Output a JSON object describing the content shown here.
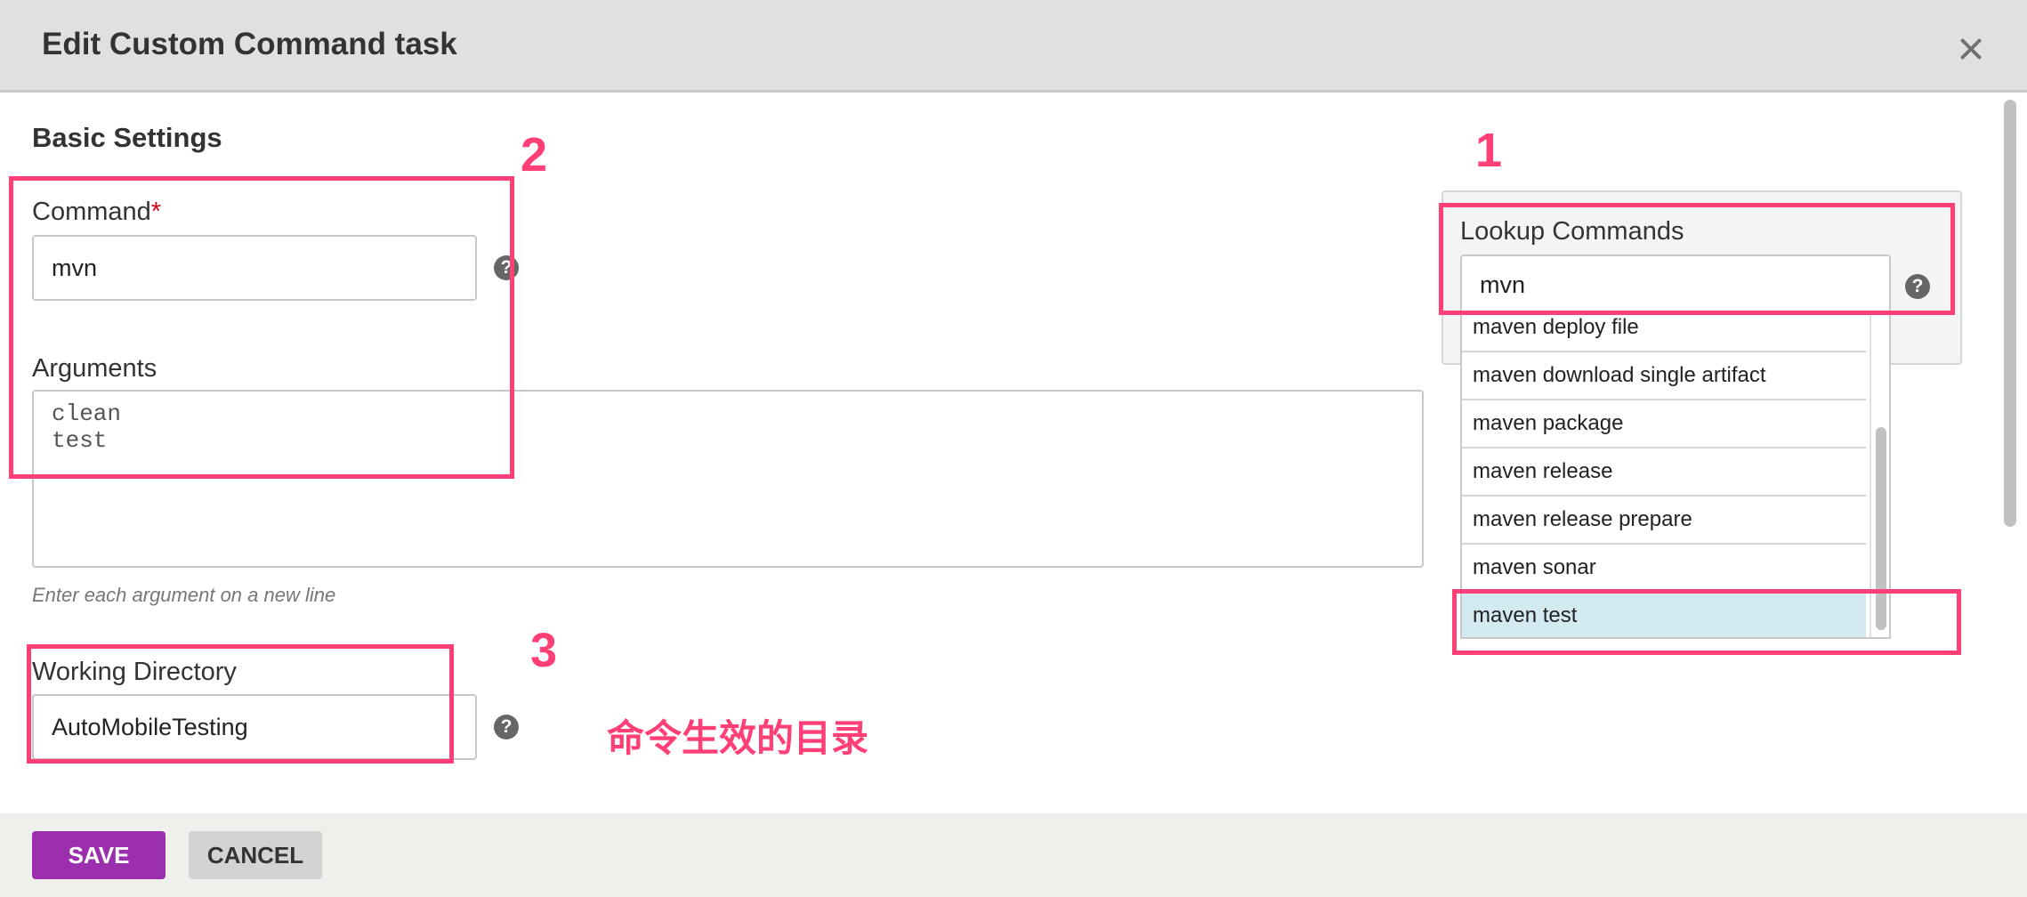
{
  "dialog": {
    "title": "Edit Custom Command task",
    "close_label": "×"
  },
  "basic_settings": {
    "title": "Basic Settings",
    "command": {
      "label": "Command",
      "required_mark": "*",
      "value": "mvn"
    },
    "arguments": {
      "label": "Arguments",
      "value": "clean\ntest",
      "hint": "Enter each argument on a new line"
    },
    "working_directory": {
      "label": "Working Directory",
      "value": "AutoMobileTesting"
    },
    "help_glyph": "?"
  },
  "lookup": {
    "label": "Lookup Commands",
    "value": "mvn",
    "items": [
      {
        "label": "maven deploy file",
        "selected": false
      },
      {
        "label": "maven download single artifact",
        "selected": false
      },
      {
        "label": "maven package",
        "selected": false
      },
      {
        "label": "maven release",
        "selected": false
      },
      {
        "label": "maven release prepare",
        "selected": false
      },
      {
        "label": "maven sonar",
        "selected": false
      },
      {
        "label": "maven test",
        "selected": true
      }
    ]
  },
  "annotations": {
    "num1": "1",
    "num2": "2",
    "num3": "3",
    "note": "命令生效的目录",
    "color": "#ff3f75"
  },
  "footer": {
    "save_label": "SAVE",
    "cancel_label": "CANCEL",
    "save_color": "#9b2fae"
  },
  "icons": {
    "close": "close-icon",
    "help": "help-icon"
  }
}
